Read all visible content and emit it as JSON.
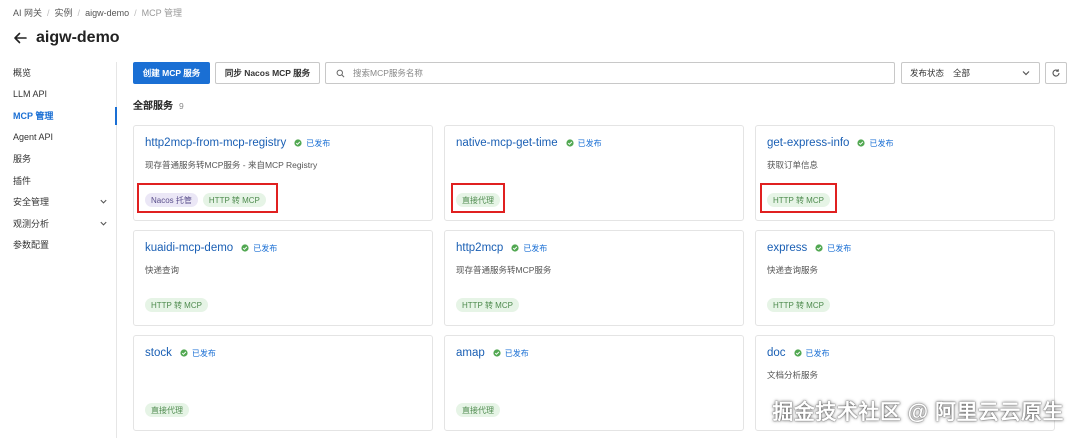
{
  "breadcrumb": {
    "items": [
      "AI 网关",
      "实例",
      "aigw-demo",
      "MCP 管理"
    ]
  },
  "page": {
    "title": "aigw-demo"
  },
  "sidebar": {
    "items": [
      {
        "label": "概览"
      },
      {
        "label": "LLM API"
      },
      {
        "label": "MCP 管理"
      },
      {
        "label": "Agent API"
      },
      {
        "label": "服务"
      },
      {
        "label": "插件"
      },
      {
        "label": "安全管理"
      },
      {
        "label": "观测分析"
      },
      {
        "label": "参数配置"
      }
    ]
  },
  "toolbar": {
    "create_label": "创建 MCP 服务",
    "sync_label": "同步 Nacos MCP 服务",
    "search_placeholder": "搜索MCP服务名称",
    "filter_label": "发布状态",
    "filter_value": "全部"
  },
  "section": {
    "title": "全部服务",
    "count": "9"
  },
  "services": [
    {
      "name": "http2mcp-from-mcp-registry",
      "status": "已发布",
      "desc": "现存普通服务转MCP服务 - 来自MCP Registry",
      "tags": [
        "Nacos 托管",
        "HTTP 转 MCP"
      ]
    },
    {
      "name": "native-mcp-get-time",
      "status": "已发布",
      "desc": "",
      "tags": [
        "直接代理"
      ]
    },
    {
      "name": "get-express-info",
      "status": "已发布",
      "desc": "获取订单信息",
      "tags": [
        "HTTP 转 MCP"
      ]
    },
    {
      "name": "kuaidi-mcp-demo",
      "status": "已发布",
      "desc": "快递查询",
      "tags": [
        "HTTP 转 MCP"
      ]
    },
    {
      "name": "http2mcp",
      "status": "已发布",
      "desc": "现存普通服务转MCP服务",
      "tags": [
        "HTTP 转 MCP"
      ]
    },
    {
      "name": "express",
      "status": "已发布",
      "desc": "快递查询服务",
      "tags": [
        "HTTP 转 MCP"
      ]
    },
    {
      "name": "stock",
      "status": "已发布",
      "desc": "",
      "tags": [
        "直接代理"
      ]
    },
    {
      "name": "amap",
      "status": "已发布",
      "desc": "",
      "tags": [
        "直接代理"
      ]
    },
    {
      "name": "doc",
      "status": "已发布",
      "desc": "文档分析服务",
      "tags": []
    }
  ],
  "colors": {
    "accent": "#1a6fd4",
    "published": "#52a852",
    "highlight": "#e02020"
  },
  "watermark": "掘金技术社区 @ 阿里云云原生"
}
